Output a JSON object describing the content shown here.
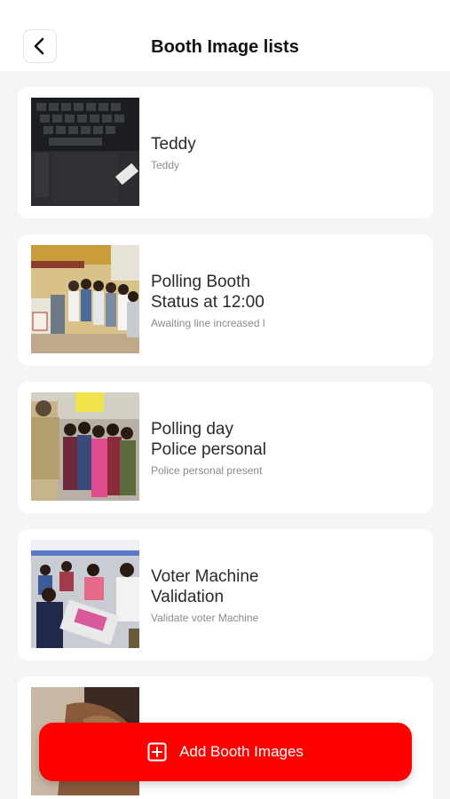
{
  "header": {
    "title": "Booth Image lists",
    "back_icon": "chevron-left-icon"
  },
  "booths": [
    {
      "title": "Teddy",
      "subtitle": "Teddy",
      "image": "laptop-keyboard-photo"
    },
    {
      "title": "Polling Booth\nStatus at 12:00",
      "subtitle": "Awaiting line increased l",
      "image": "queue-at-booth-photo"
    },
    {
      "title": "Polling day\nPolice personal",
      "subtitle": "Police personal present",
      "image": "police-and-voters-photo"
    },
    {
      "title": "Voter Machine\nValidation",
      "subtitle": "Validate voter Machine",
      "image": "voting-machine-check-photo"
    },
    {
      "title": "",
      "subtitle": "",
      "image": "hand-ink-photo"
    }
  ],
  "add_button": {
    "label": "Add Booth Images",
    "icon": "plus-square-icon",
    "color": "#ff0000"
  }
}
